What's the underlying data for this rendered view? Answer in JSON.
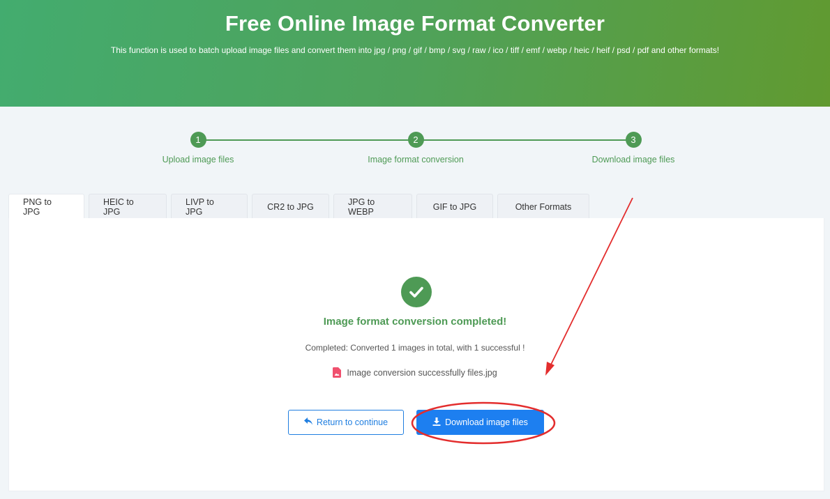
{
  "header": {
    "title": "Free Online Image Format Converter",
    "subtitle": "This function is used to batch upload image files and convert them into jpg / png / gif / bmp / svg / raw / ico / tiff / emf / webp / heic / heif / psd / pdf and other formats!"
  },
  "steps": [
    {
      "number": "1",
      "label": "Upload image files"
    },
    {
      "number": "2",
      "label": "Image format conversion"
    },
    {
      "number": "3",
      "label": "Download image files"
    }
  ],
  "tabs": [
    {
      "label": "PNG to JPG",
      "active": true
    },
    {
      "label": "HEIC to JPG",
      "active": false
    },
    {
      "label": "LIVP to JPG",
      "active": false
    },
    {
      "label": "CR2 to JPG",
      "active": false
    },
    {
      "label": "JPG to WEBP",
      "active": false
    },
    {
      "label": "GIF to JPG",
      "active": false
    },
    {
      "label": "Other Formats",
      "active": false
    }
  ],
  "result": {
    "title": "Image format conversion completed!",
    "summary": "Completed: Converted 1 images in total, with 1 successful !",
    "file_name": "Image conversion successfully files.jpg"
  },
  "buttons": {
    "return_label": "Return to continue",
    "download_label": "Download image files"
  },
  "colors": {
    "accent_green": "#4e9a55",
    "primary_blue": "#1d7ff0",
    "annotation_red": "#e32d2d",
    "file_icon": "#f0506e"
  },
  "icons": {
    "success": "check-circle-icon",
    "file": "image-file-icon",
    "return": "reply-arrow-icon",
    "download": "download-icon"
  }
}
